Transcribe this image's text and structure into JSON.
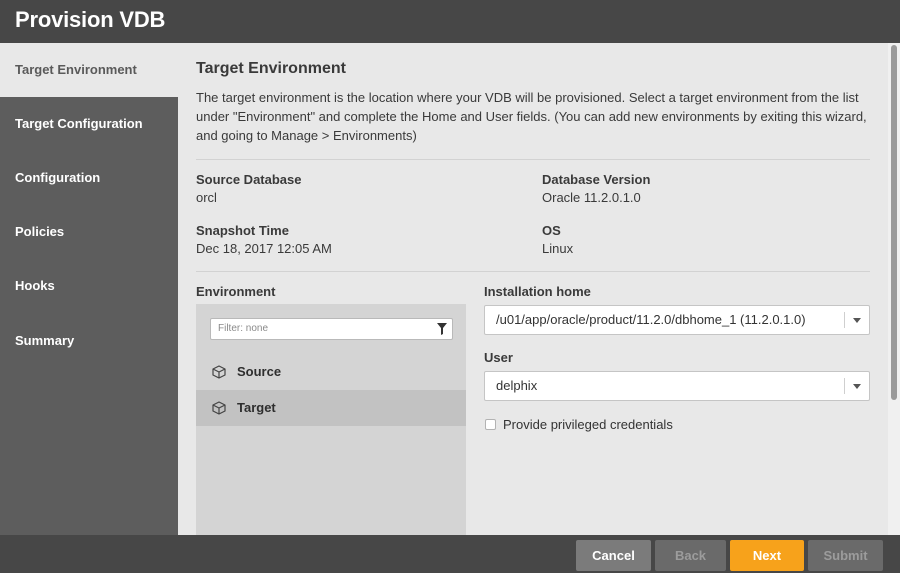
{
  "window": {
    "title": "Provision VDB"
  },
  "sidebar": {
    "items": [
      {
        "label": "Target Environment"
      },
      {
        "label": "Target Configuration"
      },
      {
        "label": "Configuration"
      },
      {
        "label": "Policies"
      },
      {
        "label": "Hooks"
      },
      {
        "label": "Summary"
      }
    ],
    "active_index": 0
  },
  "main": {
    "title": "Target Environment",
    "description": "The target environment is the location where your VDB will be provisioned. Select a target environment from the list under \"Environment\" and complete the Home and User fields. (You can add new environments by exiting this wizard, and going to Manage > Environments)",
    "info": {
      "source_database_label": "Source Database",
      "source_database_value": "orcl",
      "database_version_label": "Database Version",
      "database_version_value": "Oracle 11.2.0.1.0",
      "snapshot_time_label": "Snapshot Time",
      "snapshot_time_value": "Dec 18, 2017 12:05 AM",
      "os_label": "OS",
      "os_value": "Linux"
    },
    "environment": {
      "label": "Environment",
      "filter_placeholder": "Filter: none",
      "items": [
        {
          "label": "Source",
          "icon": "cube-icon"
        },
        {
          "label": "Target",
          "icon": "cube-icon"
        }
      ],
      "selected": "Target"
    },
    "installation_home": {
      "label": "Installation home",
      "value": "/u01/app/oracle/product/11.2.0/dbhome_1 (11.2.0.1.0)"
    },
    "user": {
      "label": "User",
      "value": "delphix"
    },
    "privileged_checkbox": {
      "label": "Provide privileged credentials",
      "checked": false
    }
  },
  "footer": {
    "cancel_label": "Cancel",
    "back_label": "Back",
    "next_label": "Next",
    "submit_label": "Submit"
  },
  "colors": {
    "header_bg": "#474747",
    "sidebar_bg": "#5d5d5d",
    "accent": "#f7a21b"
  }
}
